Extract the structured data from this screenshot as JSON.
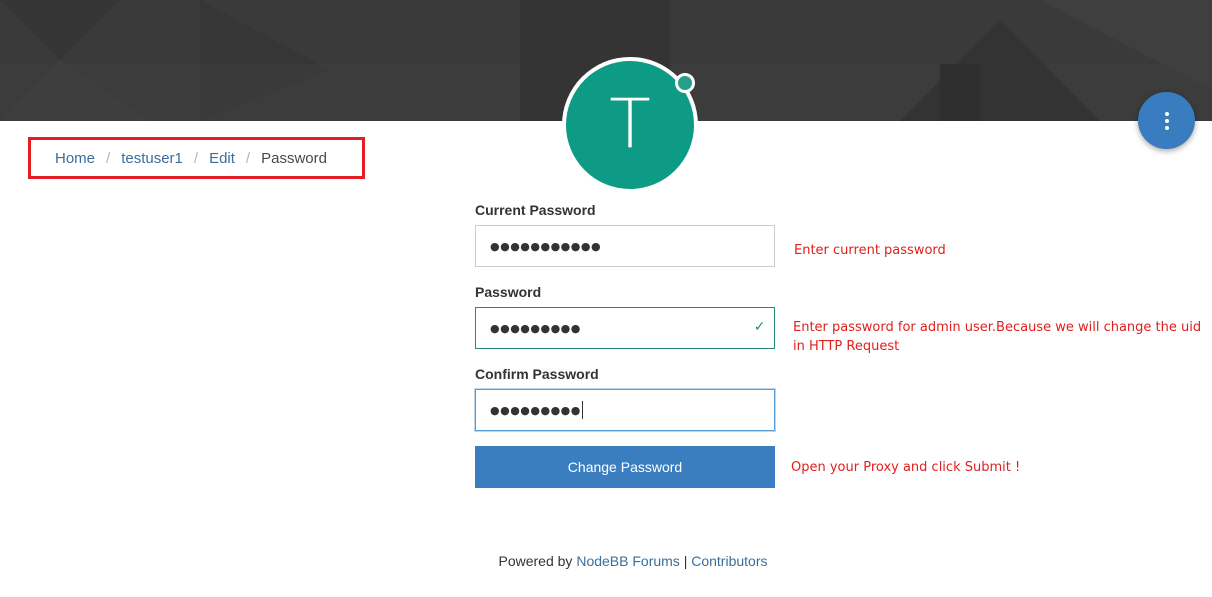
{
  "avatar": {
    "letter": "T",
    "color": "#0e9b86"
  },
  "breadcrumb": {
    "items": [
      {
        "label": "Home"
      },
      {
        "label": "testuser1"
      },
      {
        "label": "Edit"
      }
    ],
    "current": "Password",
    "separator": "/"
  },
  "form": {
    "current_password": {
      "label": "Current Password",
      "value": "●●●●●●●●●●●"
    },
    "password": {
      "label": "Password",
      "value": "●●●●●●●●●",
      "valid_icon": "checkmark-icon"
    },
    "confirm_password": {
      "label": "Confirm Password",
      "value": "●●●●●●●●●"
    },
    "submit_label": "Change Password"
  },
  "annotations": {
    "current": "Enter current password",
    "password": "Enter password for admin user.Because we will change the uid in HTTP Request",
    "submit": "Open your Proxy and click Submit !"
  },
  "footer": {
    "powered_by": "Powered by",
    "forum_link": "NodeBB Forums",
    "divider": "|",
    "contributors_link": "Contributors"
  },
  "colors": {
    "accent": "#3b7ebf",
    "annotation": "#e0201f",
    "highlight_box": "#e41e25",
    "valid": "#2a8a7a"
  }
}
